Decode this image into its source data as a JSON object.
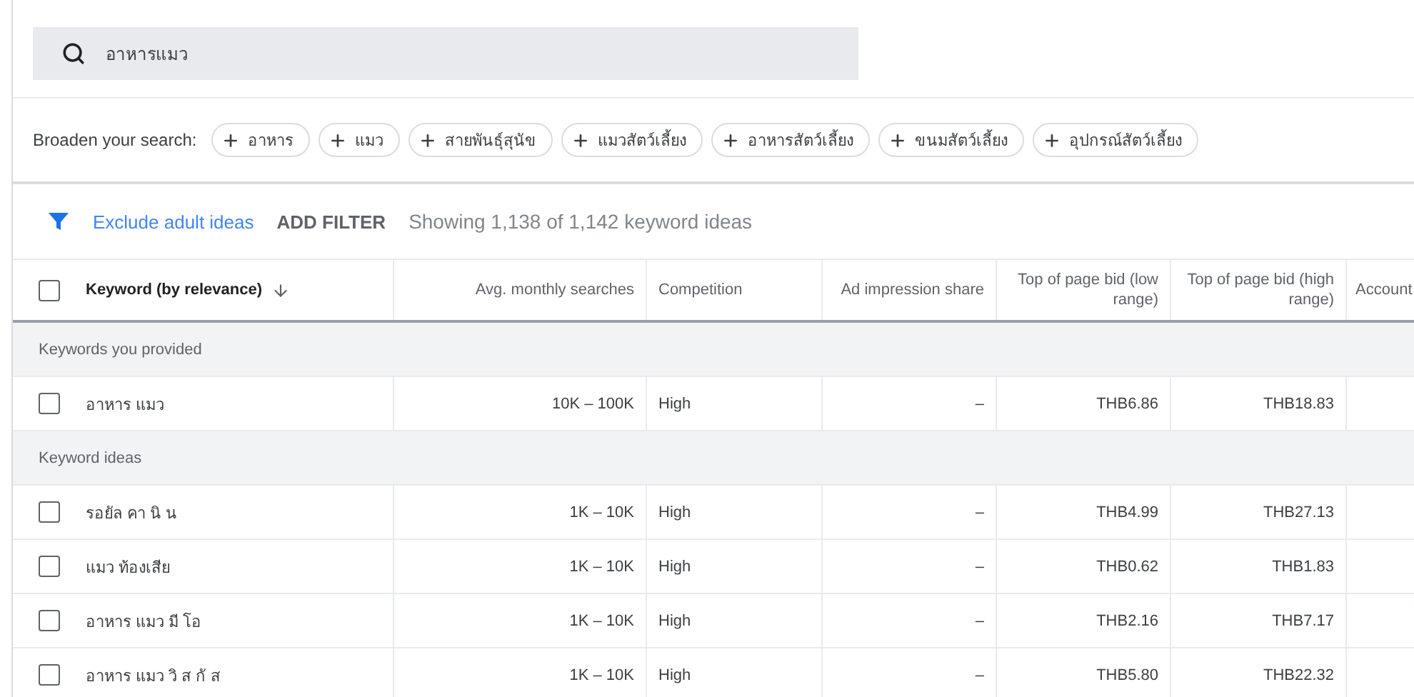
{
  "search": {
    "value": "อาหารแมว"
  },
  "broaden": {
    "label": "Broaden your search:",
    "chips": [
      "อาหาร",
      "แมว",
      "สายพันธุ์สุนัข",
      "แมวสัตว์เลี้ยง",
      "อาหารสัตว์เลี้ยง",
      "ขนมสัตว์เลี้ยง",
      "อุปกรณ์สัตว์เลี้ยง"
    ]
  },
  "filter_bar": {
    "exclude_link": "Exclude adult ideas",
    "add_filter": "ADD FILTER",
    "summary": "Showing 1,138 of 1,142 keyword ideas"
  },
  "table": {
    "header_checked": false,
    "columns": [
      "Keyword (by relevance)",
      "Avg. monthly searches",
      "Competition",
      "Ad impression share",
      "Top of page bid (low range)",
      "Top of page bid (high range)",
      "Account"
    ],
    "rows": [
      {
        "kind": "group",
        "label": "Keywords you provided"
      },
      {
        "kind": "keyword",
        "checked": false,
        "cells": [
          "อาหาร แมว",
          "10K – 100K",
          "High",
          "–",
          "THB6.86",
          "THB18.83"
        ]
      },
      {
        "kind": "group",
        "label": "Keyword ideas"
      },
      {
        "kind": "keyword",
        "checked": false,
        "cells": [
          "รอยัล คา นิ น",
          "1K – 10K",
          "High",
          "–",
          "THB4.99",
          "THB27.13"
        ]
      },
      {
        "kind": "keyword",
        "checked": false,
        "cells": [
          "แมว ท้องเสีย",
          "1K – 10K",
          "High",
          "–",
          "THB0.62",
          "THB1.83"
        ]
      },
      {
        "kind": "keyword",
        "checked": false,
        "cells": [
          "อาหาร แมว มี โอ",
          "1K – 10K",
          "High",
          "–",
          "THB2.16",
          "THB7.17"
        ]
      },
      {
        "kind": "keyword",
        "checked": false,
        "cells": [
          "อาหาร แมว วิ ส กั ส",
          "1K – 10K",
          "High",
          "–",
          "THB5.80",
          "THB22.32"
        ]
      }
    ]
  }
}
